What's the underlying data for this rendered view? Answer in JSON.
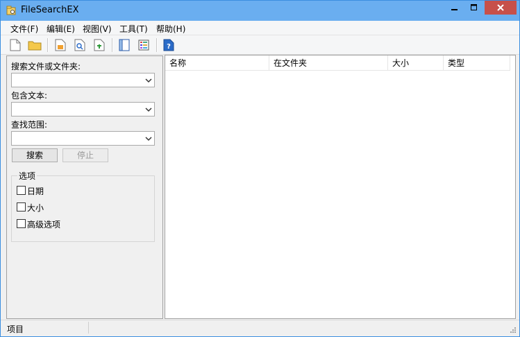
{
  "window": {
    "title": "FileSearchEX"
  },
  "menu": [
    {
      "label": "文件(F)"
    },
    {
      "label": "编辑(E)"
    },
    {
      "label": "视图(V)"
    },
    {
      "label": "工具(T)"
    },
    {
      "label": "帮助(H)"
    }
  ],
  "toolbar": {
    "icons": [
      "new-file-icon",
      "open-folder-icon",
      "export-icon",
      "find-icon",
      "save-icon",
      "panel-icon",
      "grid-view-icon",
      "help-icon"
    ]
  },
  "search_panel": {
    "name_label": "搜索文件或文件夹:",
    "name_value": "",
    "text_label": "包含文本:",
    "text_value": "",
    "scope_label": "查找范围:",
    "scope_value": "",
    "search_button": "搜索",
    "stop_button": "停止"
  },
  "options": {
    "title": "选项",
    "items": [
      {
        "label": "日期",
        "checked": false
      },
      {
        "label": "大小",
        "checked": false
      },
      {
        "label": "高级选项",
        "checked": false
      }
    ]
  },
  "results": {
    "columns": [
      "名称",
      "在文件夹",
      "大小",
      "类型"
    ],
    "rows": []
  },
  "status": {
    "text": "项目"
  },
  "colors": {
    "title_bar": "#6aaef0",
    "close_button": "#c7504a",
    "background": "#f0f0f0"
  }
}
